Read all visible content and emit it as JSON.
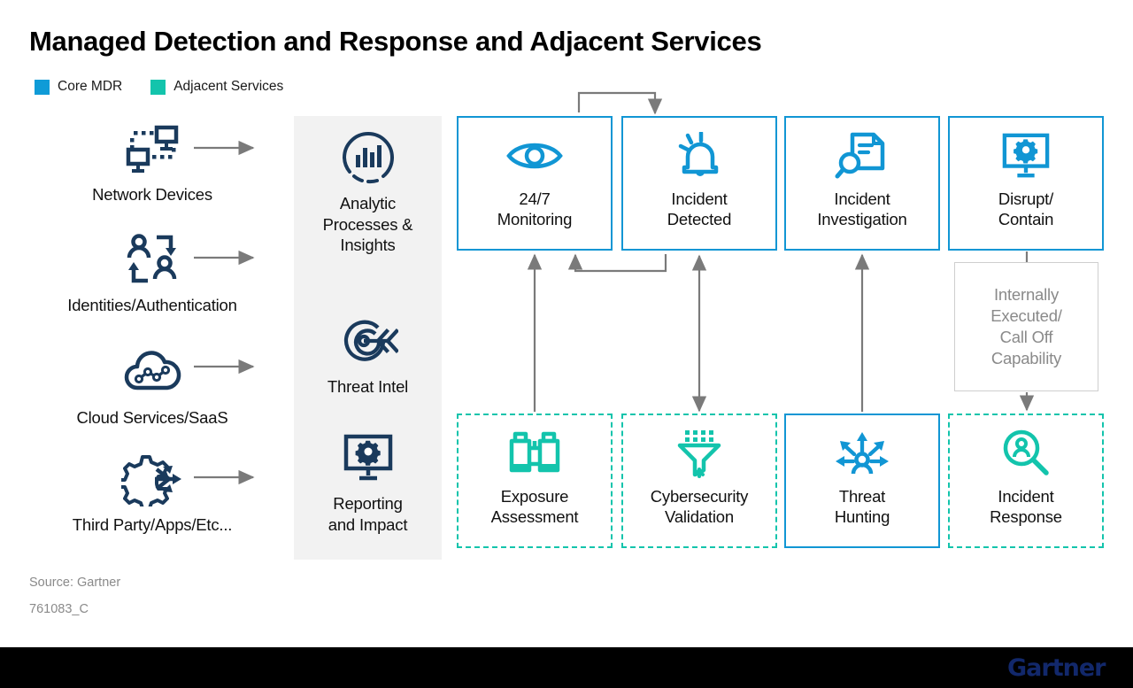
{
  "header": {
    "title": "Managed Detection and Response and Adjacent Services"
  },
  "legend": {
    "items": [
      {
        "label": "Core MDR",
        "color": "#0f9bd7"
      },
      {
        "label": "Adjacent Services",
        "color": "#13c4ac"
      }
    ]
  },
  "colors": {
    "core_mdr_blue": "#1196d4",
    "adjacent_teal": "#13c4ac",
    "icon_navy": "#1a3a5c",
    "connector_gray": "#7a7a7a",
    "panel_gray": "#f2f2f2",
    "muted_text": "#8a8a8a",
    "logo_blue": "#12286b"
  },
  "sources": {
    "items": [
      {
        "label": "Network Devices",
        "icon": "network-devices-icon"
      },
      {
        "label": "Identities/Authentication",
        "icon": "identities-authentication-icon"
      },
      {
        "label": "Cloud Services/SaaS",
        "icon": "cloud-services-icon"
      },
      {
        "label": "Third Party/Apps/Etc...",
        "icon": "third-party-apps-icon"
      }
    ]
  },
  "capabilities_panel": {
    "items": [
      {
        "label": "Analytic Processes & Insights",
        "icon": "analytics-chart-icon"
      },
      {
        "label": "Threat Intel",
        "icon": "target-arrow-icon"
      },
      {
        "label": "Reporting and Impact",
        "icon": "monitor-gear-icon"
      }
    ]
  },
  "process": {
    "top_row": [
      {
        "label": "24/7 Monitoring",
        "icon": "eye-icon",
        "category": "Core MDR",
        "style": "solid"
      },
      {
        "label": "Incident Detected",
        "icon": "alert-bell-icon",
        "category": "Core MDR",
        "style": "solid"
      },
      {
        "label": "Incident Investigation",
        "icon": "document-magnifier-icon",
        "category": "Core MDR",
        "style": "solid"
      },
      {
        "label": "Disrupt/ Contain",
        "icon": "monitor-gear-icon",
        "category": "Core MDR",
        "style": "solid"
      }
    ],
    "bottom_row": [
      {
        "label": "Exposure Assessment",
        "icon": "binoculars-icon",
        "category": "Adjacent Services",
        "style": "dashed"
      },
      {
        "label": "Cybersecurity Validation",
        "icon": "funnel-icon",
        "category": "Adjacent Services",
        "style": "dashed"
      },
      {
        "label": "Threat Hunting",
        "icon": "person-arrows-icon",
        "category": "Core MDR",
        "style": "solid"
      },
      {
        "label": "Incident Response",
        "icon": "person-magnifier-icon",
        "category": "Adjacent Services",
        "style": "dashed"
      }
    ],
    "note_box": {
      "label": "Internally Executed/ Call Off Capability"
    }
  },
  "footer": {
    "source": "Source: Gartner",
    "doc_id": "761083_C",
    "logo_text": "Gartner"
  }
}
